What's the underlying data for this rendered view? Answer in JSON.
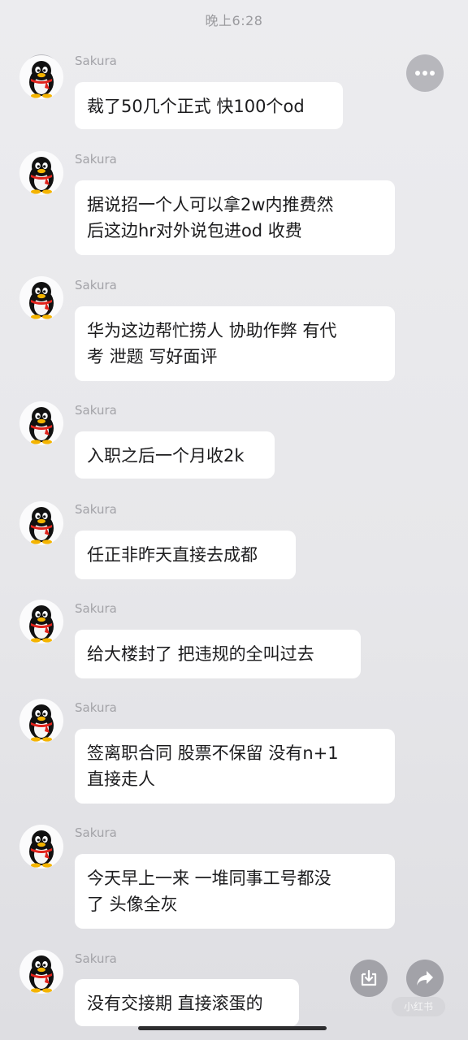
{
  "status_bar": {
    "time": "晚上6:28"
  },
  "top_bar": {
    "close_icon": "close-icon",
    "more_icon": "more-icon"
  },
  "messages": [
    {
      "sender": "Sakura",
      "text": "裁了50几个正式 快100个od"
    },
    {
      "sender": "Sakura",
      "text": "据说招一个人可以拿2w内推费然\n后这边hr对外说包进od 收费"
    },
    {
      "sender": "Sakura",
      "text": "华为这边帮忙捞人 协助作弊 有代\n考 泄题 写好面评"
    },
    {
      "sender": "Sakura",
      "text": "入职之后一个月收2k"
    },
    {
      "sender": "Sakura",
      "text": "任正非昨天直接去成都"
    },
    {
      "sender": "Sakura",
      "text": "给大楼封了 把违规的全叫过去"
    },
    {
      "sender": "Sakura",
      "text": "签离职合同 股票不保留 没有n+1\n直接走人"
    },
    {
      "sender": "Sakura",
      "text": "今天早上一来 一堆同事工号都没\n了 头像全灰"
    },
    {
      "sender": "Sakura",
      "text": "没有交接期 直接滚蛋的"
    }
  ],
  "floating_actions": {
    "download_icon": "download-icon",
    "share_icon": "share-icon"
  },
  "watermark": {
    "text": "小红书"
  }
}
